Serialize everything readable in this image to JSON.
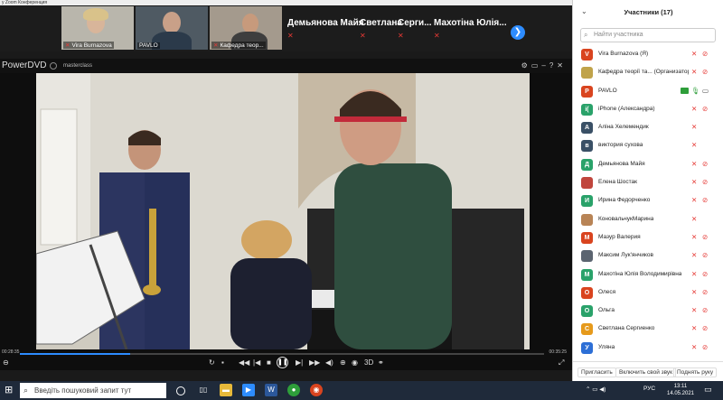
{
  "window": {
    "title": "у Zoom Конференция"
  },
  "gallery": {
    "tiles": [
      {
        "name": "Vira Burnazova",
        "muted": true
      },
      {
        "name": "PAVLO",
        "muted": false
      },
      {
        "name": "Кафедра теор...",
        "muted": true
      }
    ],
    "name_tiles": [
      {
        "name": "Демьянова Майя"
      },
      {
        "name": "Светлана"
      },
      {
        "name": "Серги..."
      },
      {
        "name": "Махотіна Юлія..."
      }
    ],
    "next_icon": "chevron-right-icon"
  },
  "player": {
    "app": "PowerDVD",
    "file": "masterclass",
    "time_elapsed": "00:28:35",
    "time_total": "00:35:25",
    "progress": 0.21,
    "controls_top": [
      "gear-icon",
      "display-icon",
      "minimize-icon",
      "help-icon",
      "close-icon"
    ],
    "controls_bottom": [
      "back-icon",
      "repeat-icon",
      "stop-icon",
      "prev-icon",
      "play-pause-icon",
      "next-icon",
      "volume-icon",
      "3d-icon",
      "link-icon",
      "fullscreen-icon"
    ],
    "label_3d": "3D"
  },
  "panel": {
    "title": "Участники (17)",
    "search_placeholder": "Найти участника",
    "participants": [
      {
        "initial": "V",
        "color": "#d9441f",
        "name": "Vira Burnazova (Я)",
        "mic": "muted",
        "cam": "off"
      },
      {
        "initial": "",
        "color": "#c0a34a",
        "name": "Кафедра теорії та... (Организатор)",
        "mic": "muted",
        "cam": "off"
      },
      {
        "initial": "P",
        "color": "#d9441f",
        "name": "PAVLO",
        "mic": "on",
        "cam": "on",
        "sharing": true
      },
      {
        "initial": "i(",
        "color": "#2aa26a",
        "name": "iPhone (Александра)",
        "mic": "muted",
        "cam": "off"
      },
      {
        "initial": "А",
        "color": "#3a5066",
        "name": "Аліна Хелемендик",
        "mic": "muted",
        "cam": ""
      },
      {
        "initial": "в",
        "color": "#3a5066",
        "name": "виктория сухова",
        "mic": "muted",
        "cam": ""
      },
      {
        "initial": "Д",
        "color": "#2aa26a",
        "name": "Демьянова Майя",
        "mic": "muted",
        "cam": "off"
      },
      {
        "initial": "",
        "color": "#c0463d",
        "name": "Елена Шостак",
        "mic": "muted",
        "cam": "off"
      },
      {
        "initial": "И",
        "color": "#2aa26a",
        "name": "Ирина Федорченко",
        "mic": "muted",
        "cam": "off"
      },
      {
        "initial": "",
        "color": "#b88456",
        "name": "КоновальчукМарина",
        "mic": "muted",
        "cam": ""
      },
      {
        "initial": "М",
        "color": "#d9441f",
        "name": "Мазур Валерия",
        "mic": "muted",
        "cam": "off"
      },
      {
        "initial": "",
        "color": "#5b6470",
        "name": "Максим Лук'янчиков",
        "mic": "muted",
        "cam": "off"
      },
      {
        "initial": "М",
        "color": "#2aa26a",
        "name": "Махотіна Юлія Володимирівна",
        "mic": "muted",
        "cam": "off"
      },
      {
        "initial": "О",
        "color": "#d9441f",
        "name": "Олеся",
        "mic": "muted",
        "cam": "off"
      },
      {
        "initial": "О",
        "color": "#2aa26a",
        "name": "Ольга",
        "mic": "muted",
        "cam": "off"
      },
      {
        "initial": "С",
        "color": "#e69a1c",
        "name": "Светлана Сергиенко",
        "mic": "muted",
        "cam": "off"
      },
      {
        "initial": "У",
        "color": "#2d6fd6",
        "name": "Уляна",
        "mic": "muted",
        "cam": "off"
      }
    ],
    "footer": {
      "invite": "Пригласить",
      "unmute_all": "Включить свой звук",
      "raise_hand": "Поднять руку"
    }
  },
  "taskbar": {
    "search_placeholder": "Введіть пошуковий запит тут",
    "lang": "РУС",
    "time": "13:11",
    "date": "14.05.2021"
  }
}
